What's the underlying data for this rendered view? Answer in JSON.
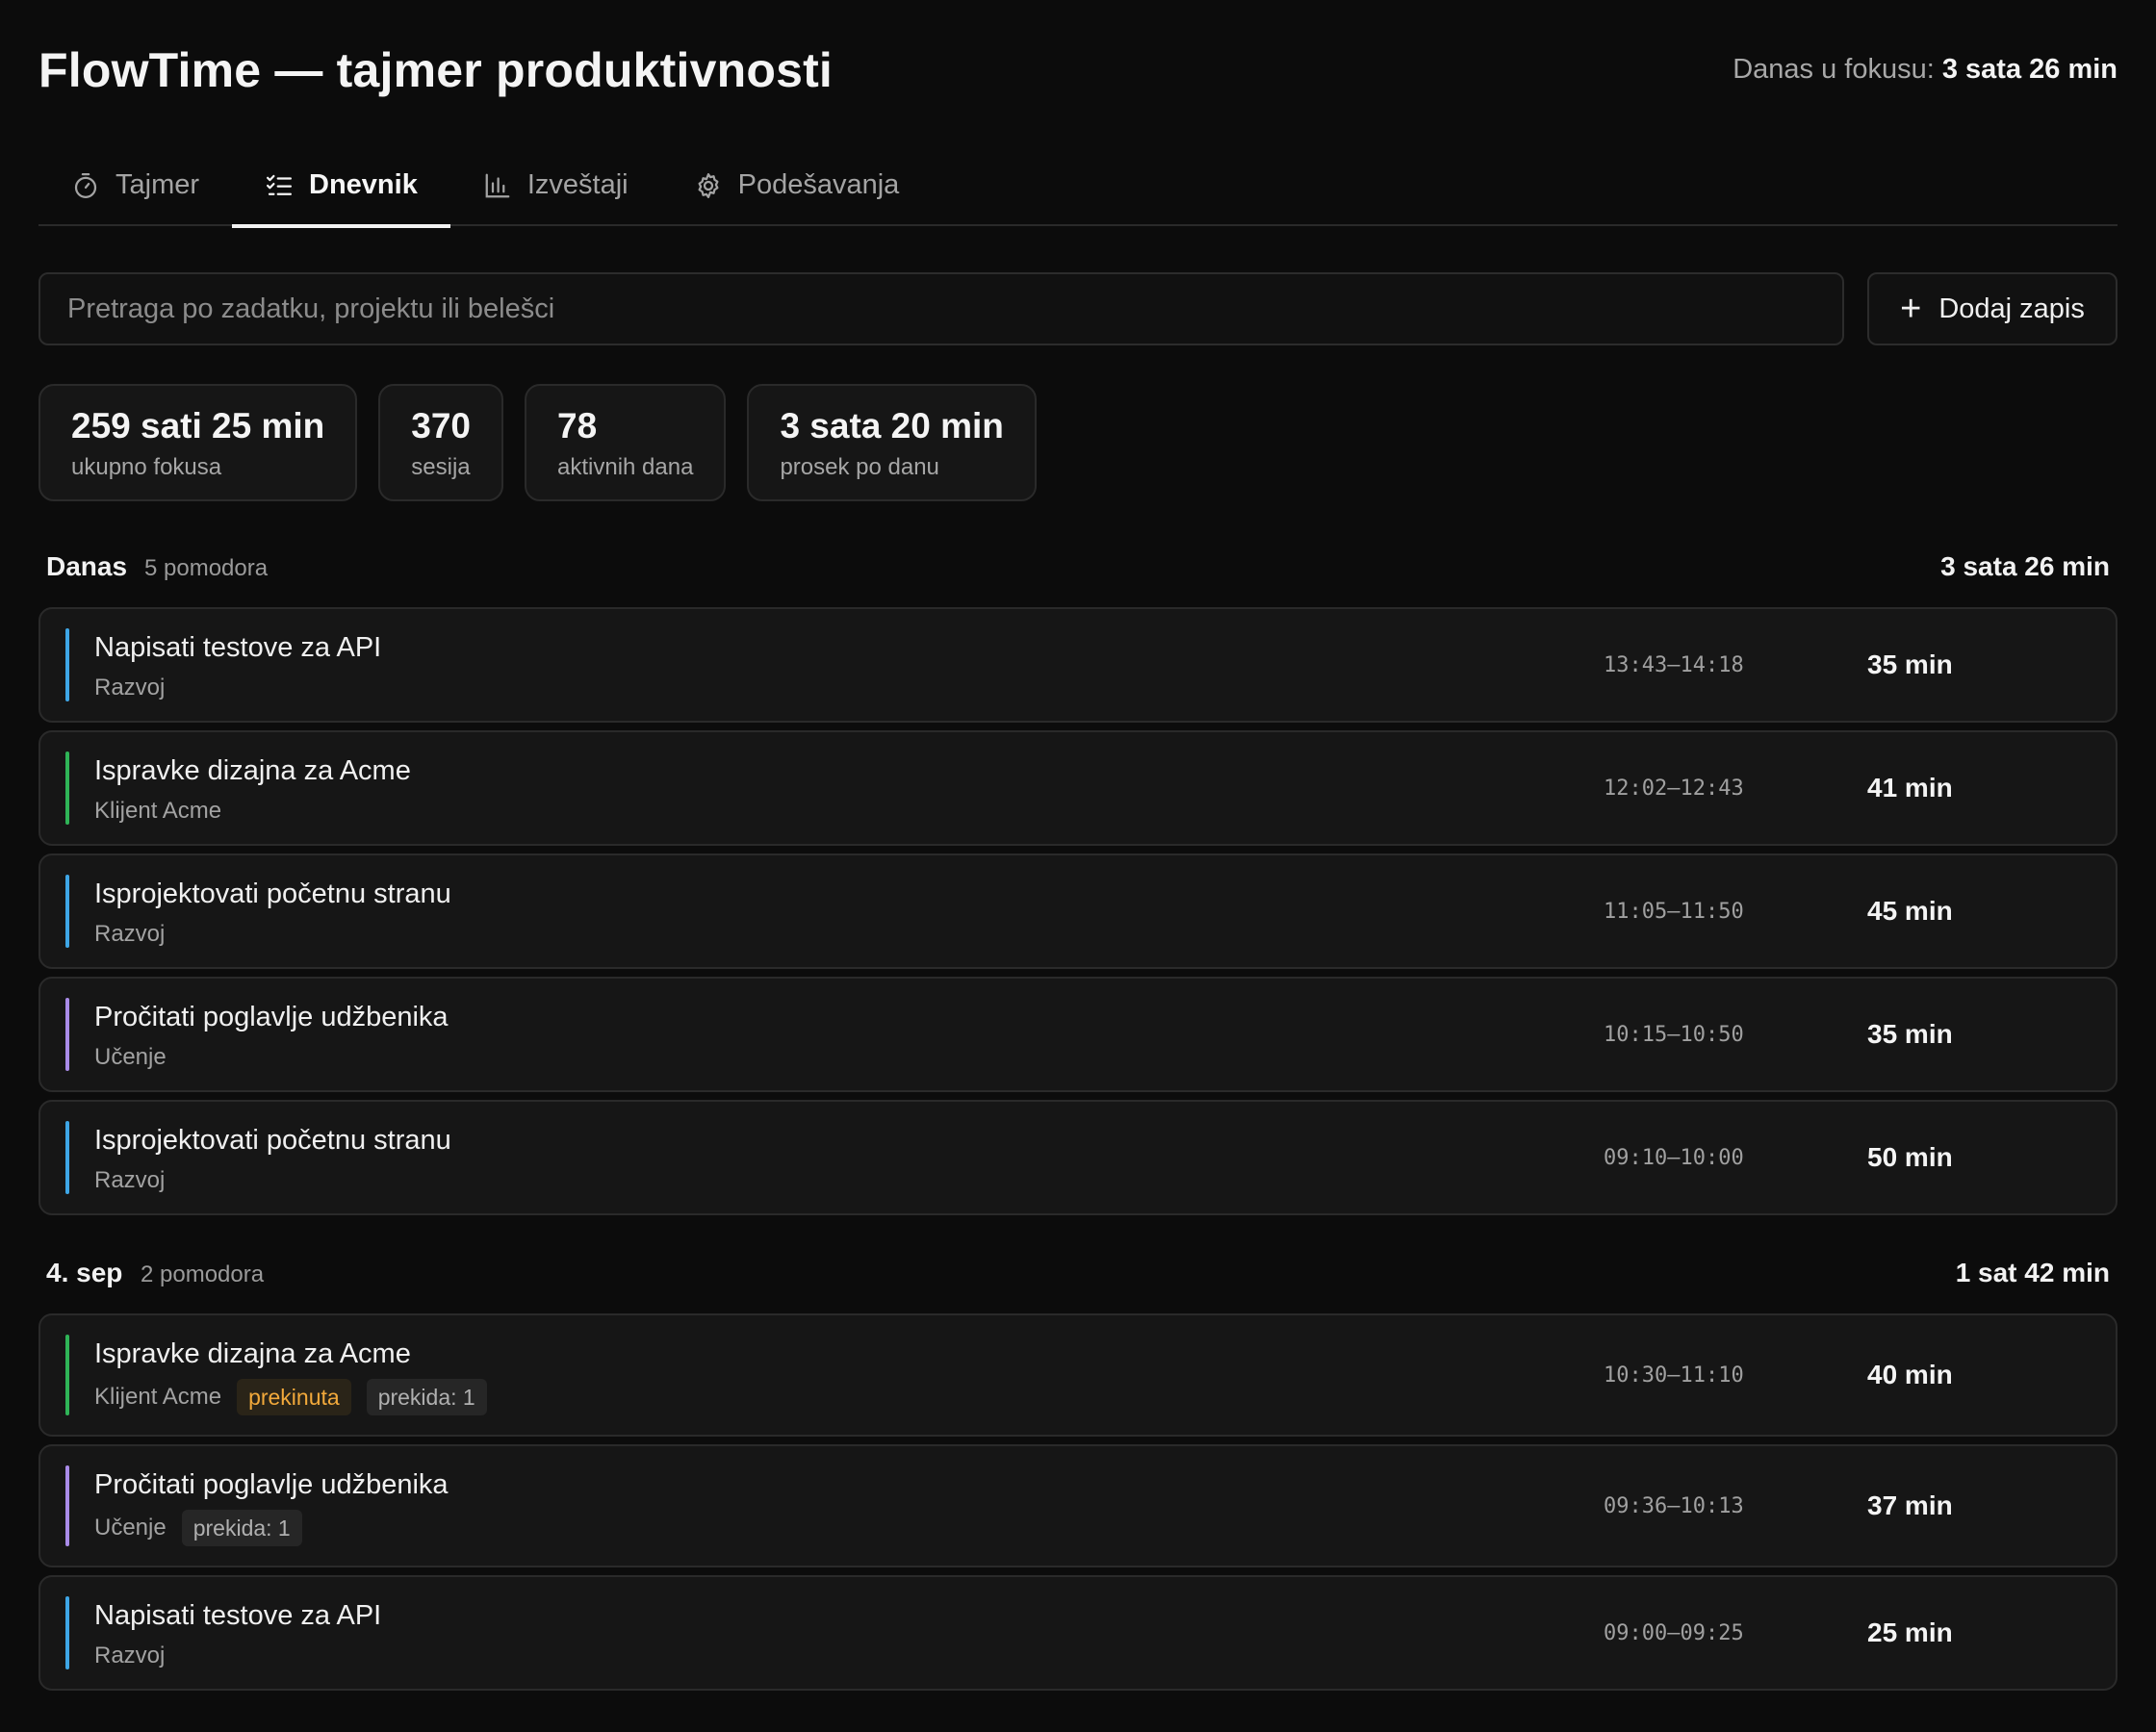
{
  "app": {
    "title": "FlowTime — tajmer produktivnosti",
    "focus_today_label": "Danas u fokusu:",
    "focus_today_value": "3 sata 26 min"
  },
  "tabs": [
    {
      "label": "Tajmer",
      "icon": "stopwatch-icon",
      "active": false
    },
    {
      "label": "Dnevnik",
      "icon": "checklist-icon",
      "active": true
    },
    {
      "label": "Izveštaji",
      "icon": "bar-chart-icon",
      "active": false
    },
    {
      "label": "Podešavanja",
      "icon": "gear-icon",
      "active": false
    }
  ],
  "toolbar": {
    "search_placeholder": "Pretraga po zadatku, projektu ili belešci",
    "search_value": "",
    "add_label": "Dodaj zapis",
    "add_icon": "plus-icon"
  },
  "stats": [
    {
      "value": "259 sati 25 min",
      "label": "ukupno fokusa"
    },
    {
      "value": "370",
      "label": "sesija"
    },
    {
      "value": "78",
      "label": "aktivnih dana"
    },
    {
      "value": "3 sata 20 min",
      "label": "prosek po danu"
    }
  ],
  "colors": {
    "Razvoj": "#3ea6e6",
    "Klijent Acme": "#2fb457",
    "Učenje": "#a98be8",
    "interrupted": "#f2a93b"
  },
  "groups": [
    {
      "day": "Danas",
      "count": "5 pomodora",
      "total": "3 sata 26 min",
      "entries": [
        {
          "task": "Napisati testove za API",
          "project": "Razvoj",
          "color": "#3ea6e6",
          "time": "13:43–14:18",
          "duration": "35 min"
        },
        {
          "task": "Ispravke dizajna za Acme",
          "project": "Klijent Acme",
          "color": "#2fb457",
          "time": "12:02–12:43",
          "duration": "41 min"
        },
        {
          "task": "Isprojektovati početnu stranu",
          "project": "Razvoj",
          "color": "#3ea6e6",
          "time": "11:05–11:50",
          "duration": "45 min"
        },
        {
          "task": "Pročitati poglavlje udžbenika",
          "project": "Učenje",
          "color": "#a98be8",
          "time": "10:15–10:50",
          "duration": "35 min"
        },
        {
          "task": "Isprojektovati početnu stranu",
          "project": "Razvoj",
          "color": "#3ea6e6",
          "time": "09:10–10:00",
          "duration": "50 min"
        }
      ]
    },
    {
      "day": "4. sep",
      "count": "2 pomodora",
      "total": "1 sat 42 min",
      "entries": [
        {
          "task": "Ispravke dizajna za Acme",
          "project": "Klijent Acme",
          "color": "#2fb457",
          "status": "prekinuta",
          "breaks": "prekida: 1",
          "time": "10:30–11:10",
          "duration": "40 min"
        },
        {
          "task": "Pročitati poglavlje udžbenika",
          "project": "Učenje",
          "color": "#a98be8",
          "breaks": "prekida: 1",
          "time": "09:36–10:13",
          "duration": "37 min"
        },
        {
          "task": "Napisati testove za API",
          "project": "Razvoj",
          "color": "#3ea6e6",
          "time": "09:00–09:25",
          "duration": "25 min"
        }
      ]
    }
  ]
}
